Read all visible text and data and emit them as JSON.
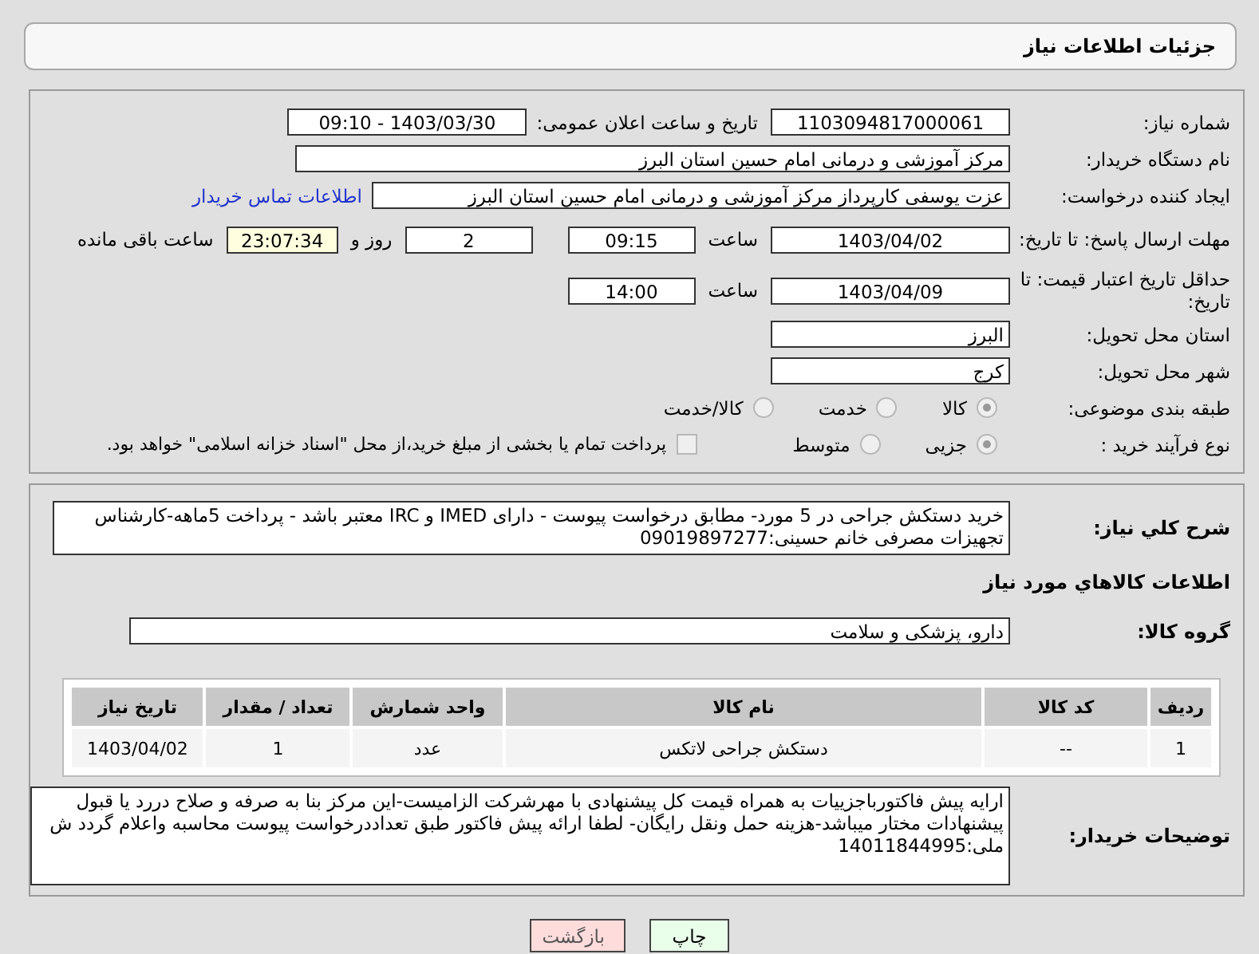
{
  "header": {
    "title": "جزئیات اطلاعات نیاز"
  },
  "need_number": {
    "label": "شماره نیاز:",
    "value": "1103094817000061"
  },
  "announce": {
    "label": "تاریخ و ساعت اعلان عمومی:",
    "value": "1403/03/30 - 09:10"
  },
  "buyer": {
    "label": "نام دستگاه خریدار:",
    "value": "مرکز آموزشی و درمانی امام حسین استان البرز"
  },
  "requester": {
    "label": "ایجاد کننده درخواست:",
    "value": "عزت یوسفی کارپرداز مرکز آموزشی و درمانی امام حسین استان البرز",
    "link": "اطلاعات تماس خریدار"
  },
  "deadline": {
    "label": "مهلت ارسال پاسخ: تا تاریخ:",
    "date": "1403/04/02",
    "time_label": "ساعت",
    "time": "09:15",
    "days": "2",
    "days_label": "روز و",
    "remaining": "23:07:34",
    "remaining_label": "ساعت باقی مانده"
  },
  "validity": {
    "label": "حداقل تاریخ اعتبار قیمت: تا تاریخ:",
    "date": "1403/04/09",
    "time_label": "ساعت",
    "time": "14:00"
  },
  "province": {
    "label": "استان محل تحویل:",
    "value": "البرز"
  },
  "city": {
    "label": "شهر محل تحویل:",
    "value": "کرج"
  },
  "category": {
    "label": "طبقه بندی موضوعی:",
    "options": [
      {
        "label": "کالا",
        "selected": true
      },
      {
        "label": "خدمت",
        "selected": false
      },
      {
        "label": "کالا/خدمت",
        "selected": false
      }
    ]
  },
  "process": {
    "label": "نوع فرآیند خرید :",
    "options": [
      {
        "label": "جزیی",
        "selected": true
      },
      {
        "label": "متوسط",
        "selected": false
      }
    ],
    "treasury": {
      "checked": false,
      "label": "پرداخت تمام یا بخشی از مبلغ خرید،از محل \"اسناد خزانه اسلامی\" خواهد بود."
    }
  },
  "description": {
    "label": "شرح کلي نياز:",
    "value": "خرید دستکش جراحی در 5 مورد- مطابق درخواست پیوست - دارای IMED  و IRC  معتبر باشد - پرداخت 5ماهه-کارشناس تجهیزات مصرفی خانم حسینی:09019897277"
  },
  "goods_heading": "اطلاعات کالاهاي مورد نياز",
  "group": {
    "label": "گروه کالا:",
    "value": "دارو، پزشکی و سلامت"
  },
  "table": {
    "columns": [
      "ردیف",
      "کد کالا",
      "نام کالا",
      "واحد شمارش",
      "تعداد / مقدار",
      "تاریخ نیاز"
    ],
    "rows": [
      [
        "1",
        "--",
        "دستکش جراحی لاتکس",
        "عدد",
        "1",
        "1403/04/02"
      ]
    ]
  },
  "notes": {
    "label": "توضیحات خریدار:",
    "value": "ارایه پیش فاکتورباجزییات به همراه قیمت کل پیشنهادی با مهرشرکت الزامیست-این مرکز بنا به صرفه و صلاح دررد یا قبول پیشنهادات مختار میباشد-هزینه حمل ونقل رایگان- لطفا ارائه پیش فاکتور طبق تعداددرخواست پیوست محاسبه واعلام گردد ش ملی:14011844995"
  },
  "buttons": [
    {
      "label": "چاپ",
      "kind": "print"
    },
    {
      "label": "بازگشت",
      "kind": "back"
    }
  ]
}
